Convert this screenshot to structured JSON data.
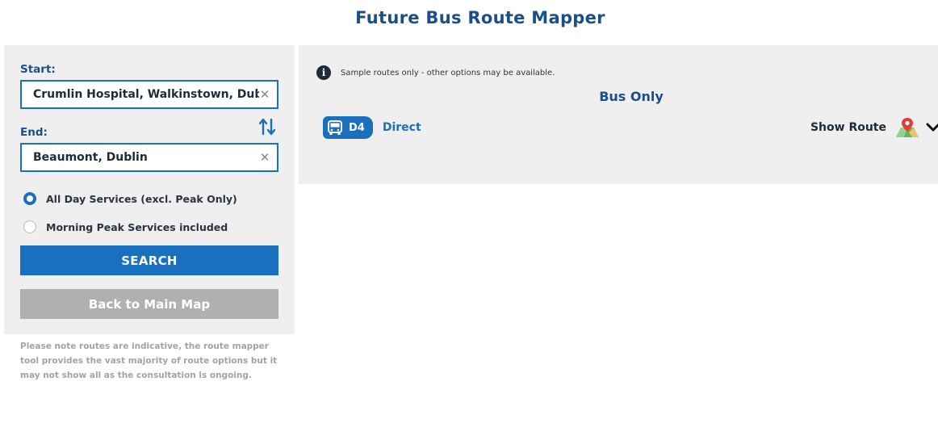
{
  "app": {
    "title": "Future Bus Route Mapper"
  },
  "search_form": {
    "start_label": "Start:",
    "start_value": "Crumlin Hospital, Walkinstown, Dublin",
    "end_label": "End:",
    "end_value": "Beaumont, Dublin",
    "options": [
      {
        "label": "All Day Services (excl. Peak Only)",
        "selected": true
      },
      {
        "label": "Morning Peak Services included",
        "selected": false
      }
    ],
    "search_label": "SEARCH",
    "back_label": "Back to Main Map"
  },
  "disclaimer": "Please note routes are indicative, the route mapper tool provides the vast majority of route options but it may not show all as the consultation is ongoing.",
  "results": {
    "info_text": "Sample routes only - other options may be available.",
    "section_title": "Bus Only",
    "routes": [
      {
        "route_code": "D4",
        "route_type": "Direct",
        "show_route_label": "Show Route"
      }
    ]
  },
  "colors": {
    "brand_blue": "#1b6fbf",
    "title_blue": "#1b4f8a",
    "panel_grey": "#efefef",
    "disabled_grey": "#b0b0b0"
  }
}
